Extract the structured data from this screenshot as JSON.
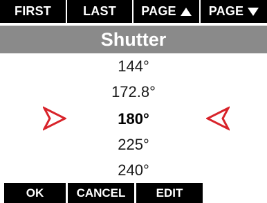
{
  "topbar": {
    "first_label": "FIRST",
    "last_label": "LAST",
    "page_up_label": "PAGE",
    "page_down_label": "PAGE"
  },
  "title": "Shutter",
  "list": {
    "items": [
      "144°",
      "172.8°",
      "180°",
      "225°",
      "240°"
    ],
    "selected_index": 2
  },
  "bottombar": {
    "ok_label": "OK",
    "cancel_label": "CANCEL",
    "edit_label": "EDIT"
  },
  "colors": {
    "bar_background": "#000000",
    "title_background": "#8a8a8a",
    "selection_arrow": "#d8232a"
  },
  "icons": {
    "page_up": "triangle-up-icon",
    "page_down": "triangle-down-icon",
    "selection_left": "selection-arrow-right-pointing-icon",
    "selection_right": "selection-arrow-left-pointing-icon"
  }
}
